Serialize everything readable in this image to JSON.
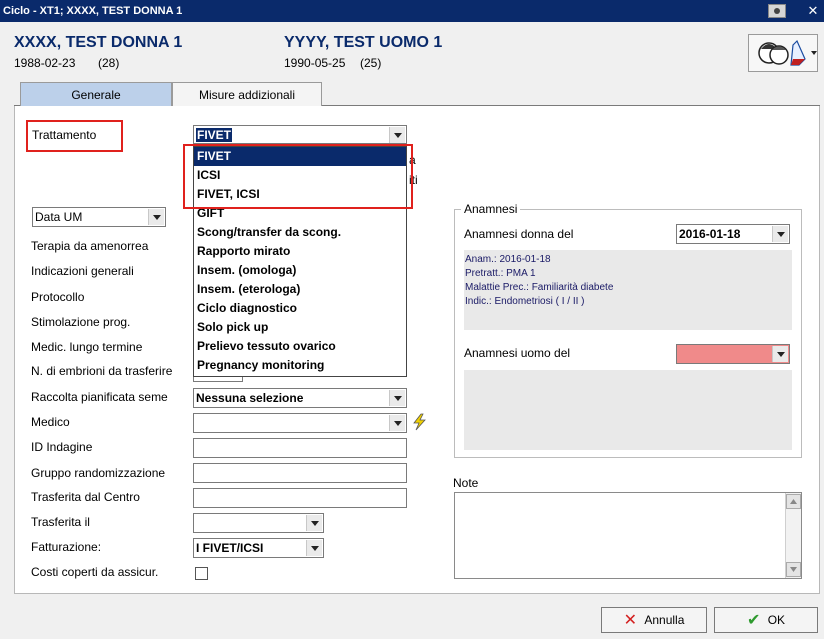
{
  "window": {
    "title": "Ciclo - XT1; XXXX, TEST DONNA 1",
    "close_glyph": "✕"
  },
  "patient_female": {
    "name": "XXXX, TEST DONNA 1",
    "dob": "1988-02-23",
    "age": "(28)"
  },
  "patient_male": {
    "name": "YYYY, TEST UOMO 1",
    "dob": "1990-05-25",
    "age": "(25)"
  },
  "tabs": [
    {
      "label": "Generale"
    },
    {
      "label": "Misure addizionali"
    }
  ],
  "left_form": {
    "trattamento_label": "Trattamento",
    "trattamento_value": "FIVET",
    "behind_text_1": "a",
    "behind_text_2": "iti",
    "data_um_value": "Data UM",
    "labels": [
      "Terapia da amenorrea",
      "Indicazioni generali",
      "Protocollo",
      "Stimolazione prog.",
      "Medic. lungo termine",
      "N. di embrioni da trasferire",
      "Raccolta pianificata seme",
      "Medico",
      "ID Indagine",
      "Gruppo randomizzazione",
      "Trasferita dal Centro",
      "Trasferita il",
      "Fatturazione:",
      "Costi coperti da assicur."
    ],
    "raccolta_value": "Nessuna selezione",
    "fatturazione_value": "I FIVET/ICSI"
  },
  "dropdown": {
    "items": [
      "FIVET",
      "ICSI",
      "FIVET, ICSI",
      "GIFT",
      "Scong/transfer da scong.",
      "Rapporto mirato",
      "Insem. (omologa)",
      "Insem. (eterologa)",
      "Ciclo diagnostico",
      "Solo pick up",
      "Prelievo tessuto ovarico",
      "Pregnancy monitoring"
    ],
    "selected_index": 0
  },
  "anamnesi": {
    "group_title": "Anamnesi",
    "donna_label": "Anamnesi donna del",
    "donna_date": "2016-01-18",
    "details": [
      "Anam.: 2016-01-18",
      "Pretratt.:  PMA 1",
      "Malattie Prec.: Familiarità diabete",
      "Indic.: Endometriosi ( I / II )"
    ],
    "uomo_label": "Anamnesi uomo del",
    "uomo_color": "#f08a8a"
  },
  "note": {
    "label": "Note"
  },
  "buttons": {
    "cancel": "Annulla",
    "ok": "OK"
  },
  "colors": {
    "title_bar": "#0a2a6b",
    "tab_active": "#bcd0ea",
    "highlight_red": "#e0211d",
    "cancel_icon": "#d32020",
    "ok_icon": "#2e9a2e"
  }
}
